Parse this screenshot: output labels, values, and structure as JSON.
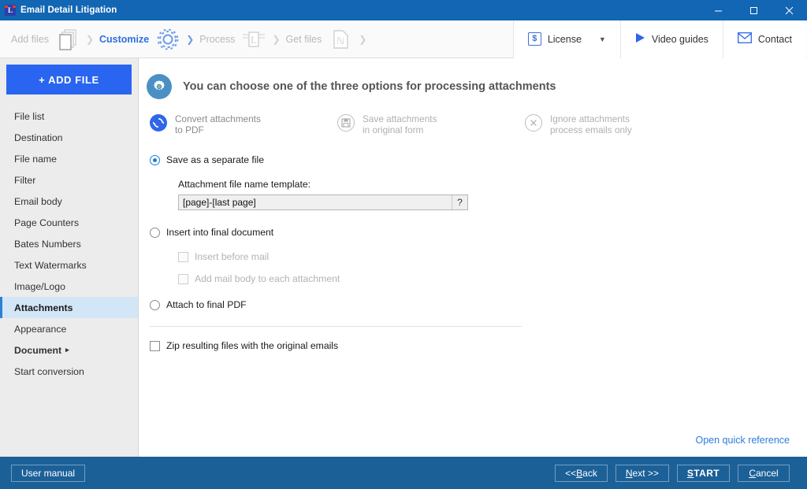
{
  "window": {
    "title": "Email Detail Litigation",
    "app_icon": "app-logo-icon",
    "minimize": "minimize-icon",
    "maximize": "maximize-icon",
    "close": "close-icon"
  },
  "toolbar": {
    "steps": [
      {
        "label": "Add files",
        "icon": "documents-icon",
        "active": false
      },
      {
        "label": "Customize",
        "icon": "gear-icon",
        "active": true
      },
      {
        "label": "Process",
        "icon": "process-icon",
        "active": false
      },
      {
        "label": "Get files",
        "icon": "pdf-icon",
        "active": false
      }
    ],
    "separator": "❯",
    "license_button": {
      "label": "License",
      "icon": "dollar-icon",
      "caret": "⌄"
    },
    "video_button": {
      "label": "Video guides",
      "icon": "play-icon"
    },
    "contact_button": {
      "label": "Contact",
      "icon": "envelope-icon"
    }
  },
  "sidebar": {
    "add_file_label": "+ ADD FILE",
    "items": [
      {
        "label": "File list",
        "selected": false,
        "bold": false,
        "arrow": ""
      },
      {
        "label": "Destination",
        "selected": false,
        "bold": false,
        "arrow": ""
      },
      {
        "label": "File name",
        "selected": false,
        "bold": false,
        "arrow": ""
      },
      {
        "label": "Filter",
        "selected": false,
        "bold": false,
        "arrow": ""
      },
      {
        "label": "Email body",
        "selected": false,
        "bold": false,
        "arrow": ""
      },
      {
        "label": "Page Counters",
        "selected": false,
        "bold": false,
        "arrow": ""
      },
      {
        "label": "Bates Numbers",
        "selected": false,
        "bold": false,
        "arrow": ""
      },
      {
        "label": "Text Watermarks",
        "selected": false,
        "bold": false,
        "arrow": ""
      },
      {
        "label": "Image/Logo",
        "selected": false,
        "bold": false,
        "arrow": ""
      },
      {
        "label": "Attachments",
        "selected": true,
        "bold": true,
        "arrow": ""
      },
      {
        "label": "Appearance",
        "selected": false,
        "bold": false,
        "arrow": ""
      },
      {
        "label": "Document",
        "selected": false,
        "bold": true,
        "arrow": "▸"
      },
      {
        "label": "Start conversion",
        "selected": false,
        "bold": false,
        "arrow": ""
      }
    ]
  },
  "main": {
    "heading": "You can choose one of the three options for processing attachments",
    "heading_icon": "gear-circle-icon",
    "options": [
      {
        "line1": "Convert attachments",
        "line2": "to PDF",
        "icon": "convert-icon",
        "active": true
      },
      {
        "line1": "Save attachments",
        "line2": "in original form",
        "icon": "save-disk-icon",
        "active": false
      },
      {
        "line1": "Ignore attachments",
        "line2": "process emails only",
        "icon": "cancel-x-icon",
        "active": false
      }
    ],
    "save_separate": {
      "label": "Save as a separate file",
      "checked": true
    },
    "template_label": "Attachment file name template:",
    "template_value": "[page]-[last page]",
    "template_placeholder": "[page]-[last page]",
    "help_label": "?",
    "insert_final": {
      "label": "Insert into final document",
      "checked": false
    },
    "insert_before_mail": {
      "label": "Insert before mail",
      "checked": false,
      "disabled": true
    },
    "add_mail_body": {
      "label": "Add mail body to each attachment",
      "checked": false,
      "disabled": true
    },
    "attach_final_pdf": {
      "label": "Attach to final PDF",
      "checked": false
    },
    "zip_resulting": {
      "label": "Zip resulting files with the original emails",
      "checked": false
    },
    "quick_reference": "Open quick reference"
  },
  "footer": {
    "user_manual": "User manual",
    "back": "<< Back",
    "next": "Next >>",
    "start": "START",
    "cancel": "Cancel"
  },
  "colors": {
    "titlebar": "#1266b3",
    "footer": "#1c6098",
    "accent_blue": "#2965f1",
    "link_blue": "#2b7ddb",
    "sidebar_bg": "#ececec",
    "selected_nav": "#d3e6f7"
  }
}
